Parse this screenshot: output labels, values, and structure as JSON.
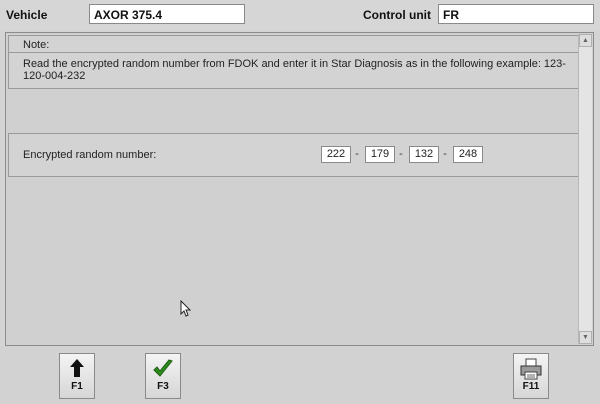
{
  "header": {
    "vehicle_label": "Vehicle",
    "vehicle_value": "AXOR 375.4",
    "control_unit_label": "Control unit",
    "control_unit_value": "FR"
  },
  "note": {
    "title": "Note:",
    "text": "Read the encrypted random number from FDOK and enter it in Star Diagnosis as in the following example: 123-120-004-232"
  },
  "encrypted": {
    "label": "Encrypted random number:",
    "segments": [
      "222",
      "179",
      "132",
      "248"
    ],
    "separator": "-"
  },
  "toolbar": {
    "f1_label": "F1",
    "f3_label": "F3",
    "f11_label": "F11"
  },
  "icons": {
    "f1": "arrow-up-icon",
    "f3": "checkmark-icon",
    "f11": "printer-icon",
    "scroll_up": "scroll-up-icon",
    "scroll_down": "scroll-down-icon",
    "cursor": "mouse-pointer-icon"
  },
  "colors": {
    "check_green": "#2e8b1e"
  }
}
